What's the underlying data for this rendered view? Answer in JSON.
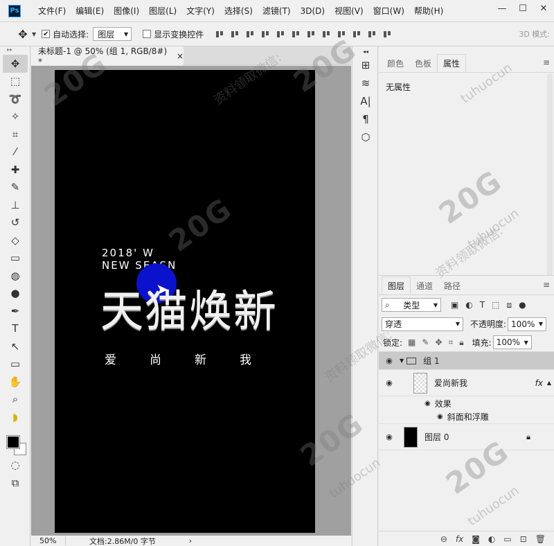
{
  "app": {
    "logo": "Ps"
  },
  "menu": [
    "文件(F)",
    "编辑(E)",
    "图像(I)",
    "图层(L)",
    "文字(Y)",
    "选择(S)",
    "滤镜(T)",
    "3D(D)",
    "视图(V)",
    "窗口(W)",
    "帮助(H)"
  ],
  "window_controls": {
    "minimize": "—",
    "maximize": "☐",
    "close": "✕"
  },
  "options": {
    "auto_select_label": "自动选择:",
    "auto_select_checked": true,
    "auto_select_value": "图层",
    "show_transform_label": "显示变换控件",
    "show_transform_checked": false,
    "mode_3d": "3D 模式:"
  },
  "document": {
    "tab_title": "未标题-1 @ 50% (组 1, RGB/8#) *",
    "close": "×",
    "zoom": "50%",
    "doc_info": "文档:2.86M/0 字节",
    "status_arrow": "›"
  },
  "artwork": {
    "line1": "2018' W",
    "line2": "NEW SEASN",
    "title": "天猫焕新",
    "subtitle": "爱尚新我"
  },
  "tools": [
    "move-tool",
    "marquee-tool",
    "lasso-tool",
    "magic-wand-tool",
    "crop-tool",
    "eyedropper-tool",
    "healing-tool",
    "brush-tool",
    "stamp-tool",
    "history-brush-tool",
    "eraser-tool",
    "gradient-tool",
    "blur-tool",
    "dodge-tool",
    "pen-tool",
    "type-tool",
    "path-select-tool",
    "shape-tool",
    "hand-tool",
    "zoom-tool",
    "banana-tool"
  ],
  "properties_panel": {
    "tabs": [
      "颜色",
      "色板",
      "属性"
    ],
    "active_tab": "属性",
    "body": "无属性"
  },
  "layers_panel": {
    "tabs": [
      "图层",
      "通道",
      "路径"
    ],
    "active_tab": "图层",
    "filter_kind": "类型",
    "blend_mode": "穿透",
    "opacity_label": "不透明度:",
    "opacity_value": "100%",
    "lock_label": "锁定:",
    "fill_label": "填充:",
    "fill_value": "100%",
    "layers": [
      {
        "name": "组 1",
        "type": "group"
      },
      {
        "name": "爱尚新我",
        "type": "text",
        "fx": "fx"
      },
      {
        "name": "图层 0",
        "type": "bg"
      }
    ],
    "effects_label": "效果",
    "effect_name": "斜面和浮雕"
  },
  "watermark": {
    "big": "20G",
    "small": "资料领取微信:",
    "brand": "tuhuocun"
  }
}
